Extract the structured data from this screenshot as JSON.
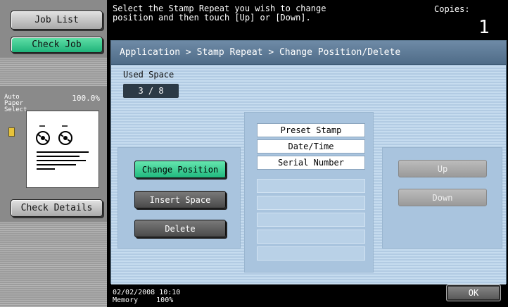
{
  "left_panel": {
    "job_list": "Job List",
    "check_job": "Check Job",
    "paper_label_line1": "Auto Paper",
    "paper_label_line2": "Select",
    "zoom": "100.0%",
    "check_details": "Check Details"
  },
  "message": {
    "line1": "Select the Stamp Repeat you wish to change",
    "line2": "position and then touch [Up] or [Down].",
    "copies_label": "Copies:",
    "copies_value": "1"
  },
  "breadcrumb": "Application > Stamp Repeat > Change Position/Delete",
  "used_space": {
    "label": "Used Space",
    "value": "3 / 8"
  },
  "actions": {
    "change_position": "Change Position",
    "insert_space": "Insert Space",
    "delete": "Delete",
    "up": "Up",
    "down": "Down",
    "ok": "OK"
  },
  "list": [
    "Preset Stamp",
    "Date/Time",
    "Serial Number",
    "",
    "",
    "",
    "",
    ""
  ],
  "status": {
    "datetime": "02/02/2008   10:10",
    "memory_label": "Memory",
    "memory_value": "100%"
  },
  "colors": {
    "accent_green": "#2cc58a",
    "panel_blue": "#b6cfe6",
    "header_blue": "#5d7a96"
  },
  "icons": [
    "tray-icon",
    "preview-icon"
  ]
}
